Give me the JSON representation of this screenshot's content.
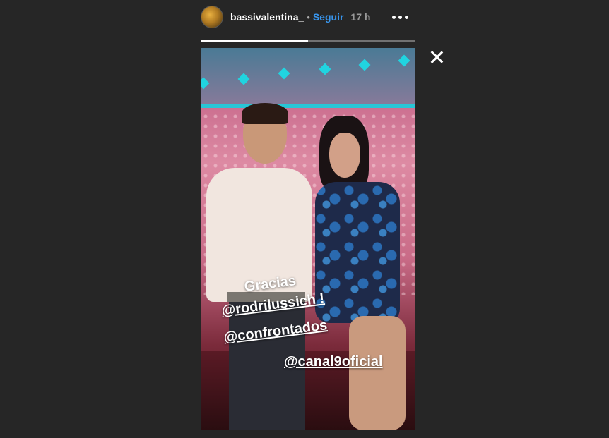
{
  "header": {
    "username": "bassivalentina_",
    "separator": "•",
    "follow_label": "Seguir",
    "time": "17 h",
    "more_icon": "more-dots-icon"
  },
  "progress": {
    "fill_fraction": 0.5
  },
  "close_icon": "close-icon",
  "story": {
    "captions": [
      "Gracias",
      "@rodrilussich !",
      "@confrontados",
      "@canal9oficial"
    ]
  },
  "colors": {
    "background": "#262626",
    "follow": "#3897f0",
    "accent_cyan": "#20d4e0"
  }
}
